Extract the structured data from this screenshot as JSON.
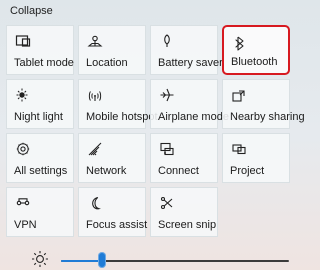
{
  "header": {
    "collapse_label": "Collapse"
  },
  "accent_colors": {
    "slider": "#1f7bd6",
    "highlight": "#d71920"
  },
  "tiles": [
    {
      "label": "Tablet mode",
      "icon": "tablet-mode-icon"
    },
    {
      "label": "Location",
      "icon": "location-icon"
    },
    {
      "label": "Battery saver",
      "icon": "battery-saver-icon"
    },
    {
      "label": "Bluetooth",
      "icon": "bluetooth-icon",
      "highlighted": true
    },
    {
      "label": "Night light",
      "icon": "night-light-icon"
    },
    {
      "label": "Mobile hotspot",
      "icon": "mobile-hotspot-icon"
    },
    {
      "label": "Airplane mode",
      "icon": "airplane-mode-icon"
    },
    {
      "label": "Nearby sharing",
      "icon": "nearby-sharing-icon"
    },
    {
      "label": "All settings",
      "icon": "all-settings-icon"
    },
    {
      "label": "Network",
      "icon": "network-icon"
    },
    {
      "label": "Connect",
      "icon": "connect-icon"
    },
    {
      "label": "Project",
      "icon": "project-icon"
    },
    {
      "label": "VPN",
      "icon": "vpn-icon"
    },
    {
      "label": "Focus assist",
      "icon": "focus-assist-icon"
    },
    {
      "label": "Screen snip",
      "icon": "screen-snip-icon"
    }
  ],
  "brightness": {
    "icon": "brightness-icon",
    "level": 0.18
  }
}
